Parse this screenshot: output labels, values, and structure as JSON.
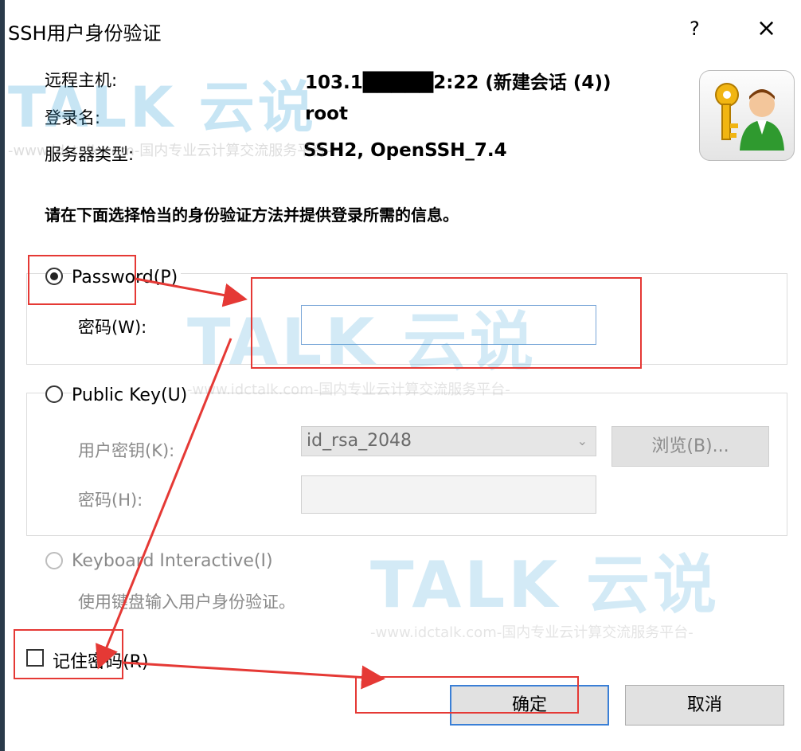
{
  "dialog": {
    "title": "SSH用户身份验证",
    "help_label": "?",
    "close_label": "×"
  },
  "info": {
    "host_label": "远程主机:",
    "host_value": "103.1█████2:22 (新建会话 (4))",
    "login_label": "登录名:",
    "login_value": "root",
    "server_type_label": "服务器类型:",
    "server_type_value": "SSH2, OpenSSH_7.4"
  },
  "instruction": "请在下面选择恰当的身份验证方法并提供登录所需的信息。",
  "password_method": {
    "label": "Password(P)",
    "selected": true,
    "password_label": "密码(W):",
    "password_value": ""
  },
  "publickey_method": {
    "label": "Public Key(U)",
    "selected": false,
    "user_key_label": "用户密钥(K):",
    "user_key_value": "id_rsa_2048",
    "browse_label": "浏览(B)...",
    "passphrase_label": "密码(H):"
  },
  "keyboard_method": {
    "label": "Keyboard Interactive(I)",
    "selected": false,
    "description": "使用键盘输入用户身份验证。"
  },
  "remember_password": {
    "label": "记住密码(R)",
    "checked": false
  },
  "buttons": {
    "ok_label": "确定",
    "cancel_label": "取消"
  },
  "watermark": {
    "brand": "TALK 云说",
    "tagline": "-www.idctalk.com-国内专业云计算交流服务平台-"
  },
  "colors": {
    "annotation_red": "#e53935",
    "focus_blue": "#3a7fd6"
  },
  "icons": {
    "dialog_icon": "key-user-icon",
    "dropdown_icon": "chevron-down-icon"
  }
}
